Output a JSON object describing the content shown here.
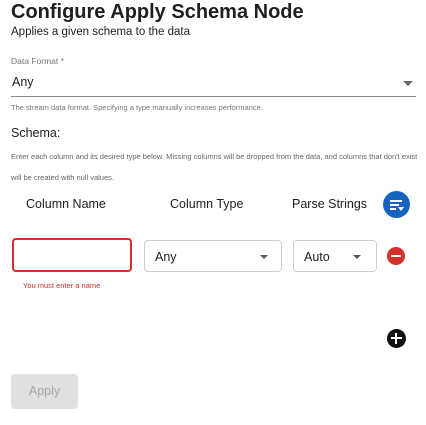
{
  "header": {
    "title": "Configure Apply Schema Node",
    "subtitle": "Applies a given schema to the data"
  },
  "data_format": {
    "label": "Data Format *",
    "value": "Any",
    "helper": "The stream data format. Specifying a type manually increases performance."
  },
  "schema": {
    "label": "Schema:",
    "description": "Enter each column and its desired type below. Missing columns will be dropped from the data, and columns that don't exist will be created with null values.",
    "columns": {
      "name": "Column Name",
      "type": "Column Type",
      "parse": "Parse Strings"
    },
    "row": {
      "name_value": "",
      "name_error": "You must enter a name",
      "type_value": "Any",
      "parse_value": "Auto"
    }
  },
  "actions": {
    "apply_label": "Apply"
  },
  "icons": {
    "sort": "sort-icon",
    "remove": "remove-circle-icon",
    "add": "add-circle-icon",
    "dropdown": "chevron-down-icon"
  },
  "colors": {
    "accent": "#1565c0",
    "error": "#d32f2f",
    "disabled_bg": "#e0e0e0"
  }
}
